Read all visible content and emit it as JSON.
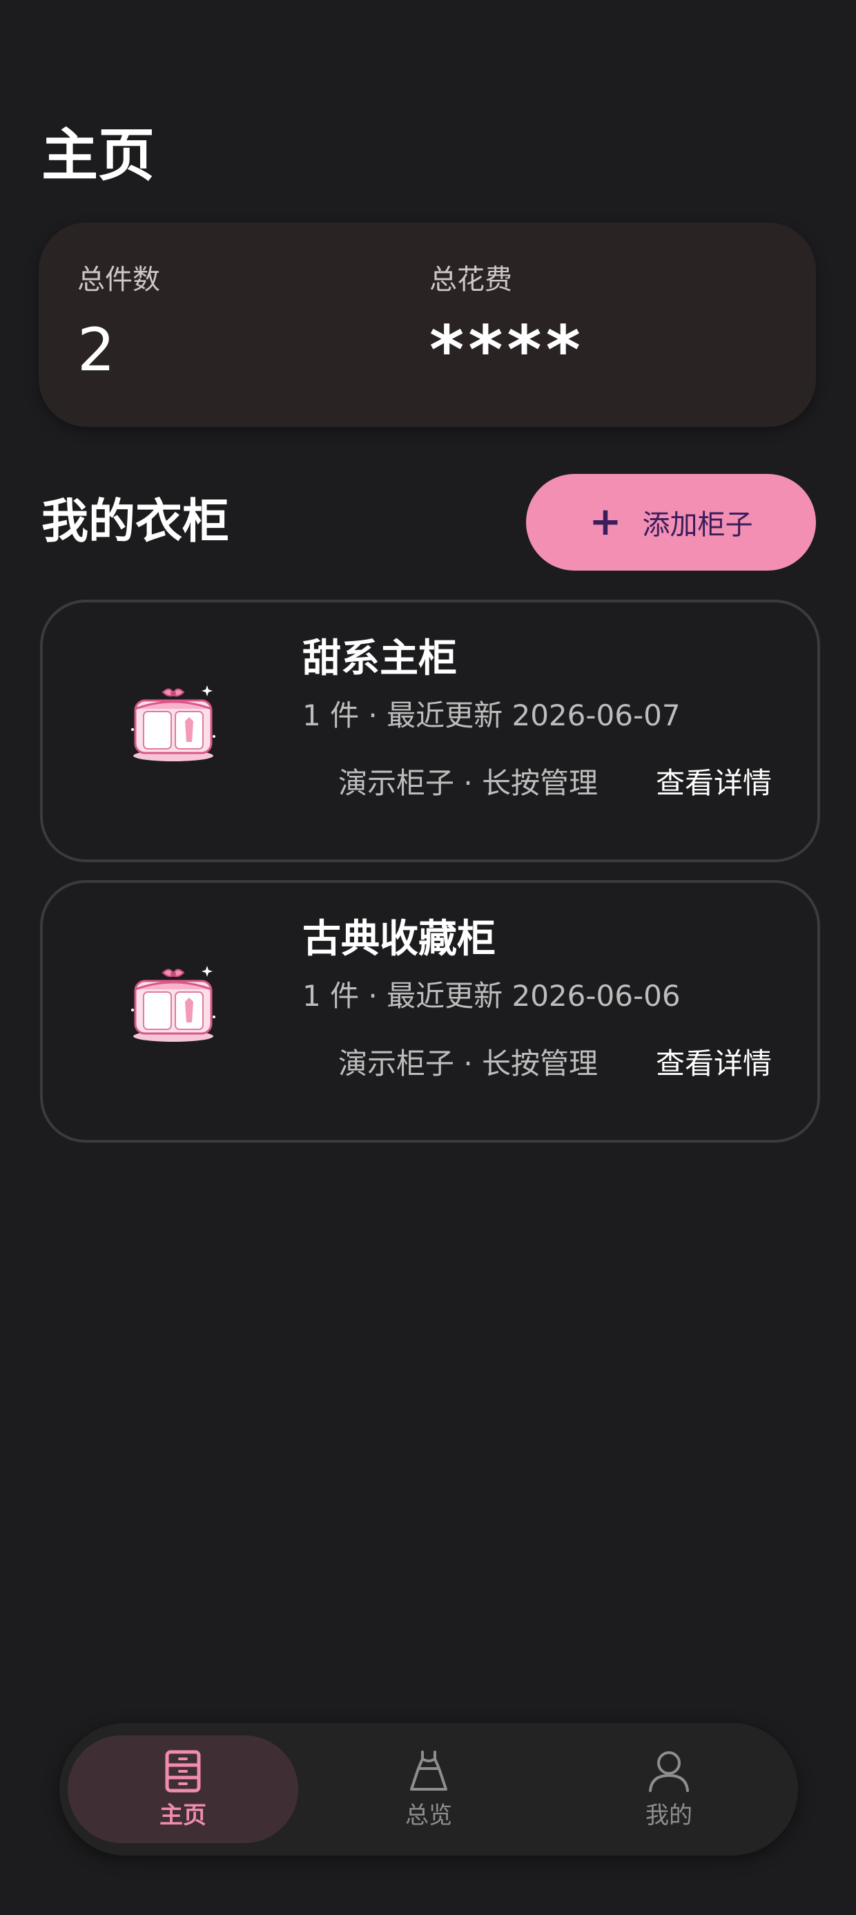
{
  "header": {
    "title": "主页"
  },
  "stats": {
    "count_label": "总件数",
    "count_value": "2",
    "cost_label": "总花费",
    "cost_value": "****"
  },
  "wardrobe": {
    "section_title": "我的衣柜",
    "add_button_label": "添加柜子",
    "cabinets": [
      {
        "name": "甜系主柜",
        "meta": "1 件 · 最近更新 2026-06-07",
        "note": "演示柜子 · 长按管理",
        "detail_label": "查看详情"
      },
      {
        "name": "古典收藏柜",
        "meta": "1 件 · 最近更新 2026-06-06",
        "note": "演示柜子 · 长按管理",
        "detail_label": "查看详情"
      }
    ]
  },
  "bottom_nav": {
    "items": [
      {
        "label": "主页",
        "icon": "cabinet-icon",
        "active": true
      },
      {
        "label": "总览",
        "icon": "dress-icon",
        "active": false
      },
      {
        "label": "我的",
        "icon": "person-icon",
        "active": false
      }
    ]
  },
  "colors": {
    "background": "#1c1c1e",
    "accent": "#f28fb3",
    "accent_text": "#3a1d5c",
    "card": "#2a2324",
    "nav_active_bg": "#3f2f34"
  }
}
